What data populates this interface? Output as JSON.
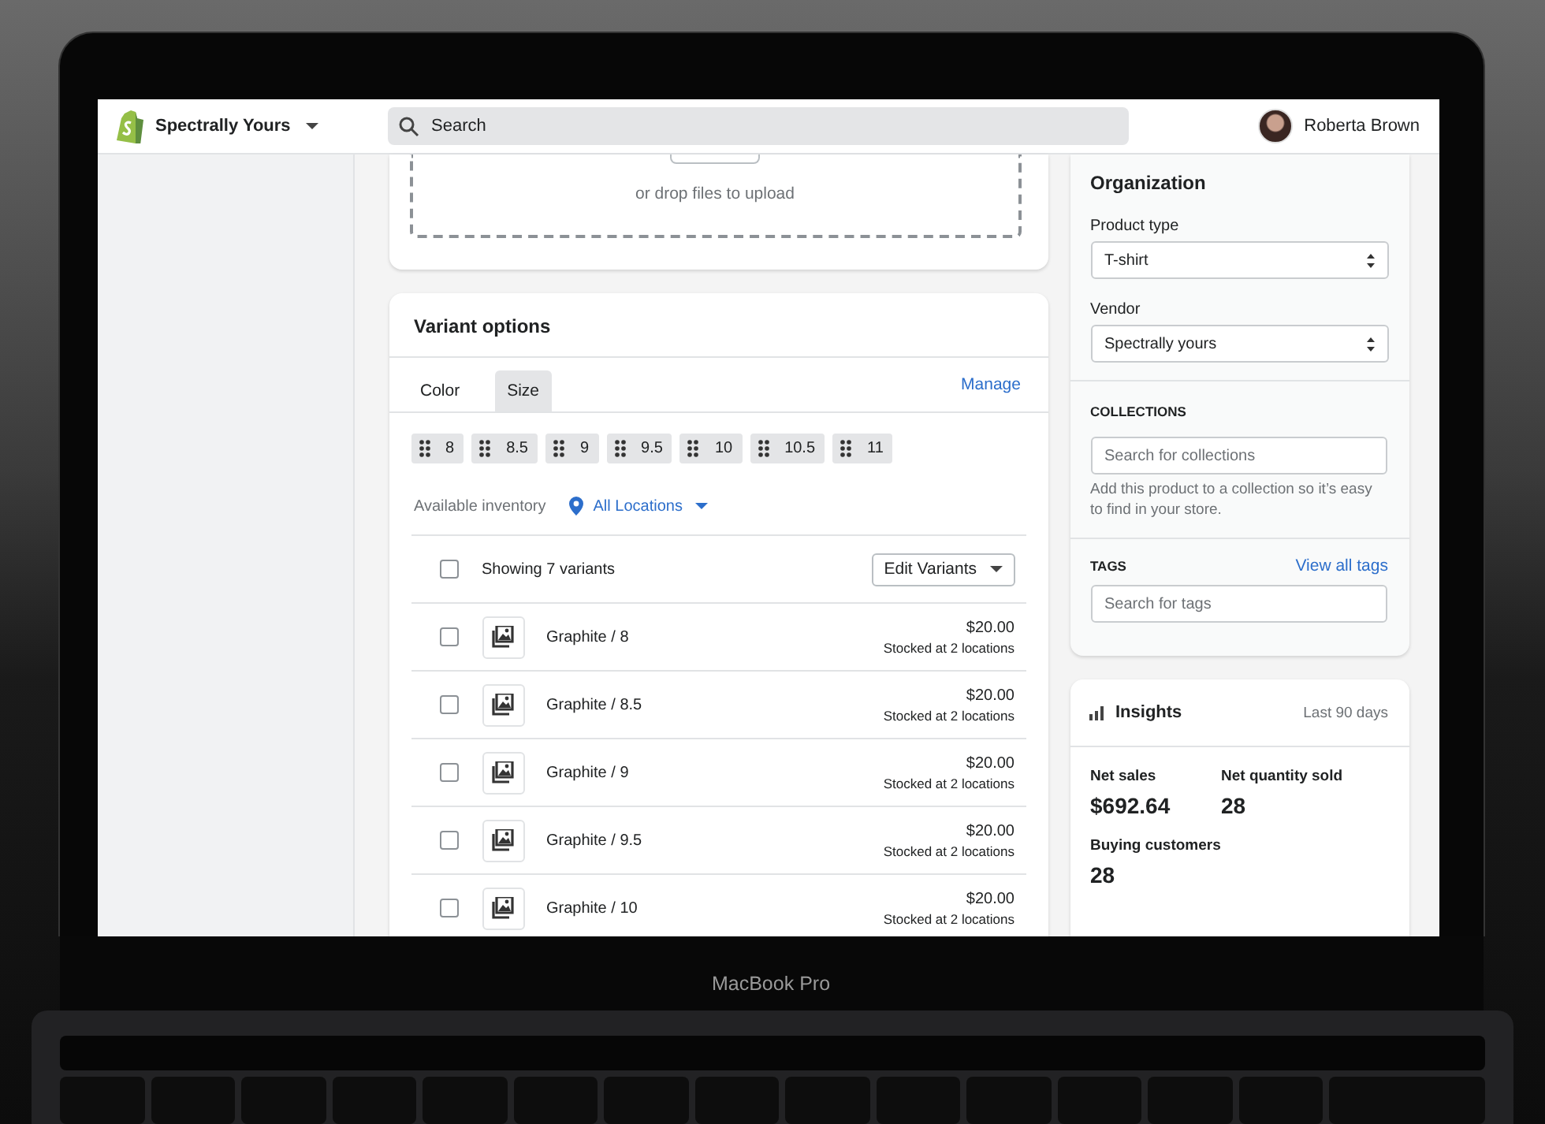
{
  "top_bar": {
    "store_name": "Spectrally Yours",
    "search": {
      "placeholder": "Search"
    },
    "user": {
      "name": "Roberta Brown"
    }
  },
  "media": {
    "hint": "or drop files to upload"
  },
  "variant_options": {
    "title": "Variant options",
    "tabs": [
      {
        "label": "Color",
        "selected": false
      },
      {
        "label": "Size",
        "selected": true
      }
    ],
    "manage_link": "Manage",
    "values": [
      "8",
      "8.5",
      "9",
      "9.5",
      "10",
      "10.5",
      "11"
    ],
    "inventory_label": "Available inventory",
    "location": "All Locations",
    "list_header": {
      "checked": false,
      "summary": "Showing 7 variants",
      "button": "Edit Variants"
    },
    "variants": [
      {
        "name": "Graphite / 8",
        "price": "$20.00",
        "stock": "Stocked at 2 locations",
        "checked": false
      },
      {
        "name": "Graphite / 8.5",
        "price": "$20.00",
        "stock": "Stocked at 2 locations",
        "checked": false
      },
      {
        "name": "Graphite / 9",
        "price": "$20.00",
        "stock": "Stocked at 2 locations",
        "checked": false
      },
      {
        "name": "Graphite / 9.5",
        "price": "$20.00",
        "stock": "Stocked at 2 locations",
        "checked": false
      },
      {
        "name": "Graphite / 10",
        "price": "$20.00",
        "stock": "Stocked at 2 locations",
        "checked": false
      }
    ]
  },
  "organization": {
    "title": "Organization",
    "product_type": {
      "label": "Product type",
      "value": "T-shirt"
    },
    "vendor": {
      "label": "Vendor",
      "value": "Spectrally yours"
    },
    "collections": {
      "heading": "COLLECTIONS",
      "placeholder": "Search for collections",
      "help": "Add this product to a collection so it’s easy to find in your store."
    },
    "tags": {
      "heading": "TAGS",
      "link": "View all tags",
      "placeholder": "Search for tags"
    }
  },
  "insights": {
    "title": "Insights",
    "period": "Last 90 days",
    "metrics": [
      {
        "label": "Net sales",
        "value": "$692.64"
      },
      {
        "label": "Net quantity sold",
        "value": "28"
      },
      {
        "label": "Buying customers",
        "value": "28"
      }
    ]
  },
  "laptop": {
    "model": "MacBook Pro"
  }
}
